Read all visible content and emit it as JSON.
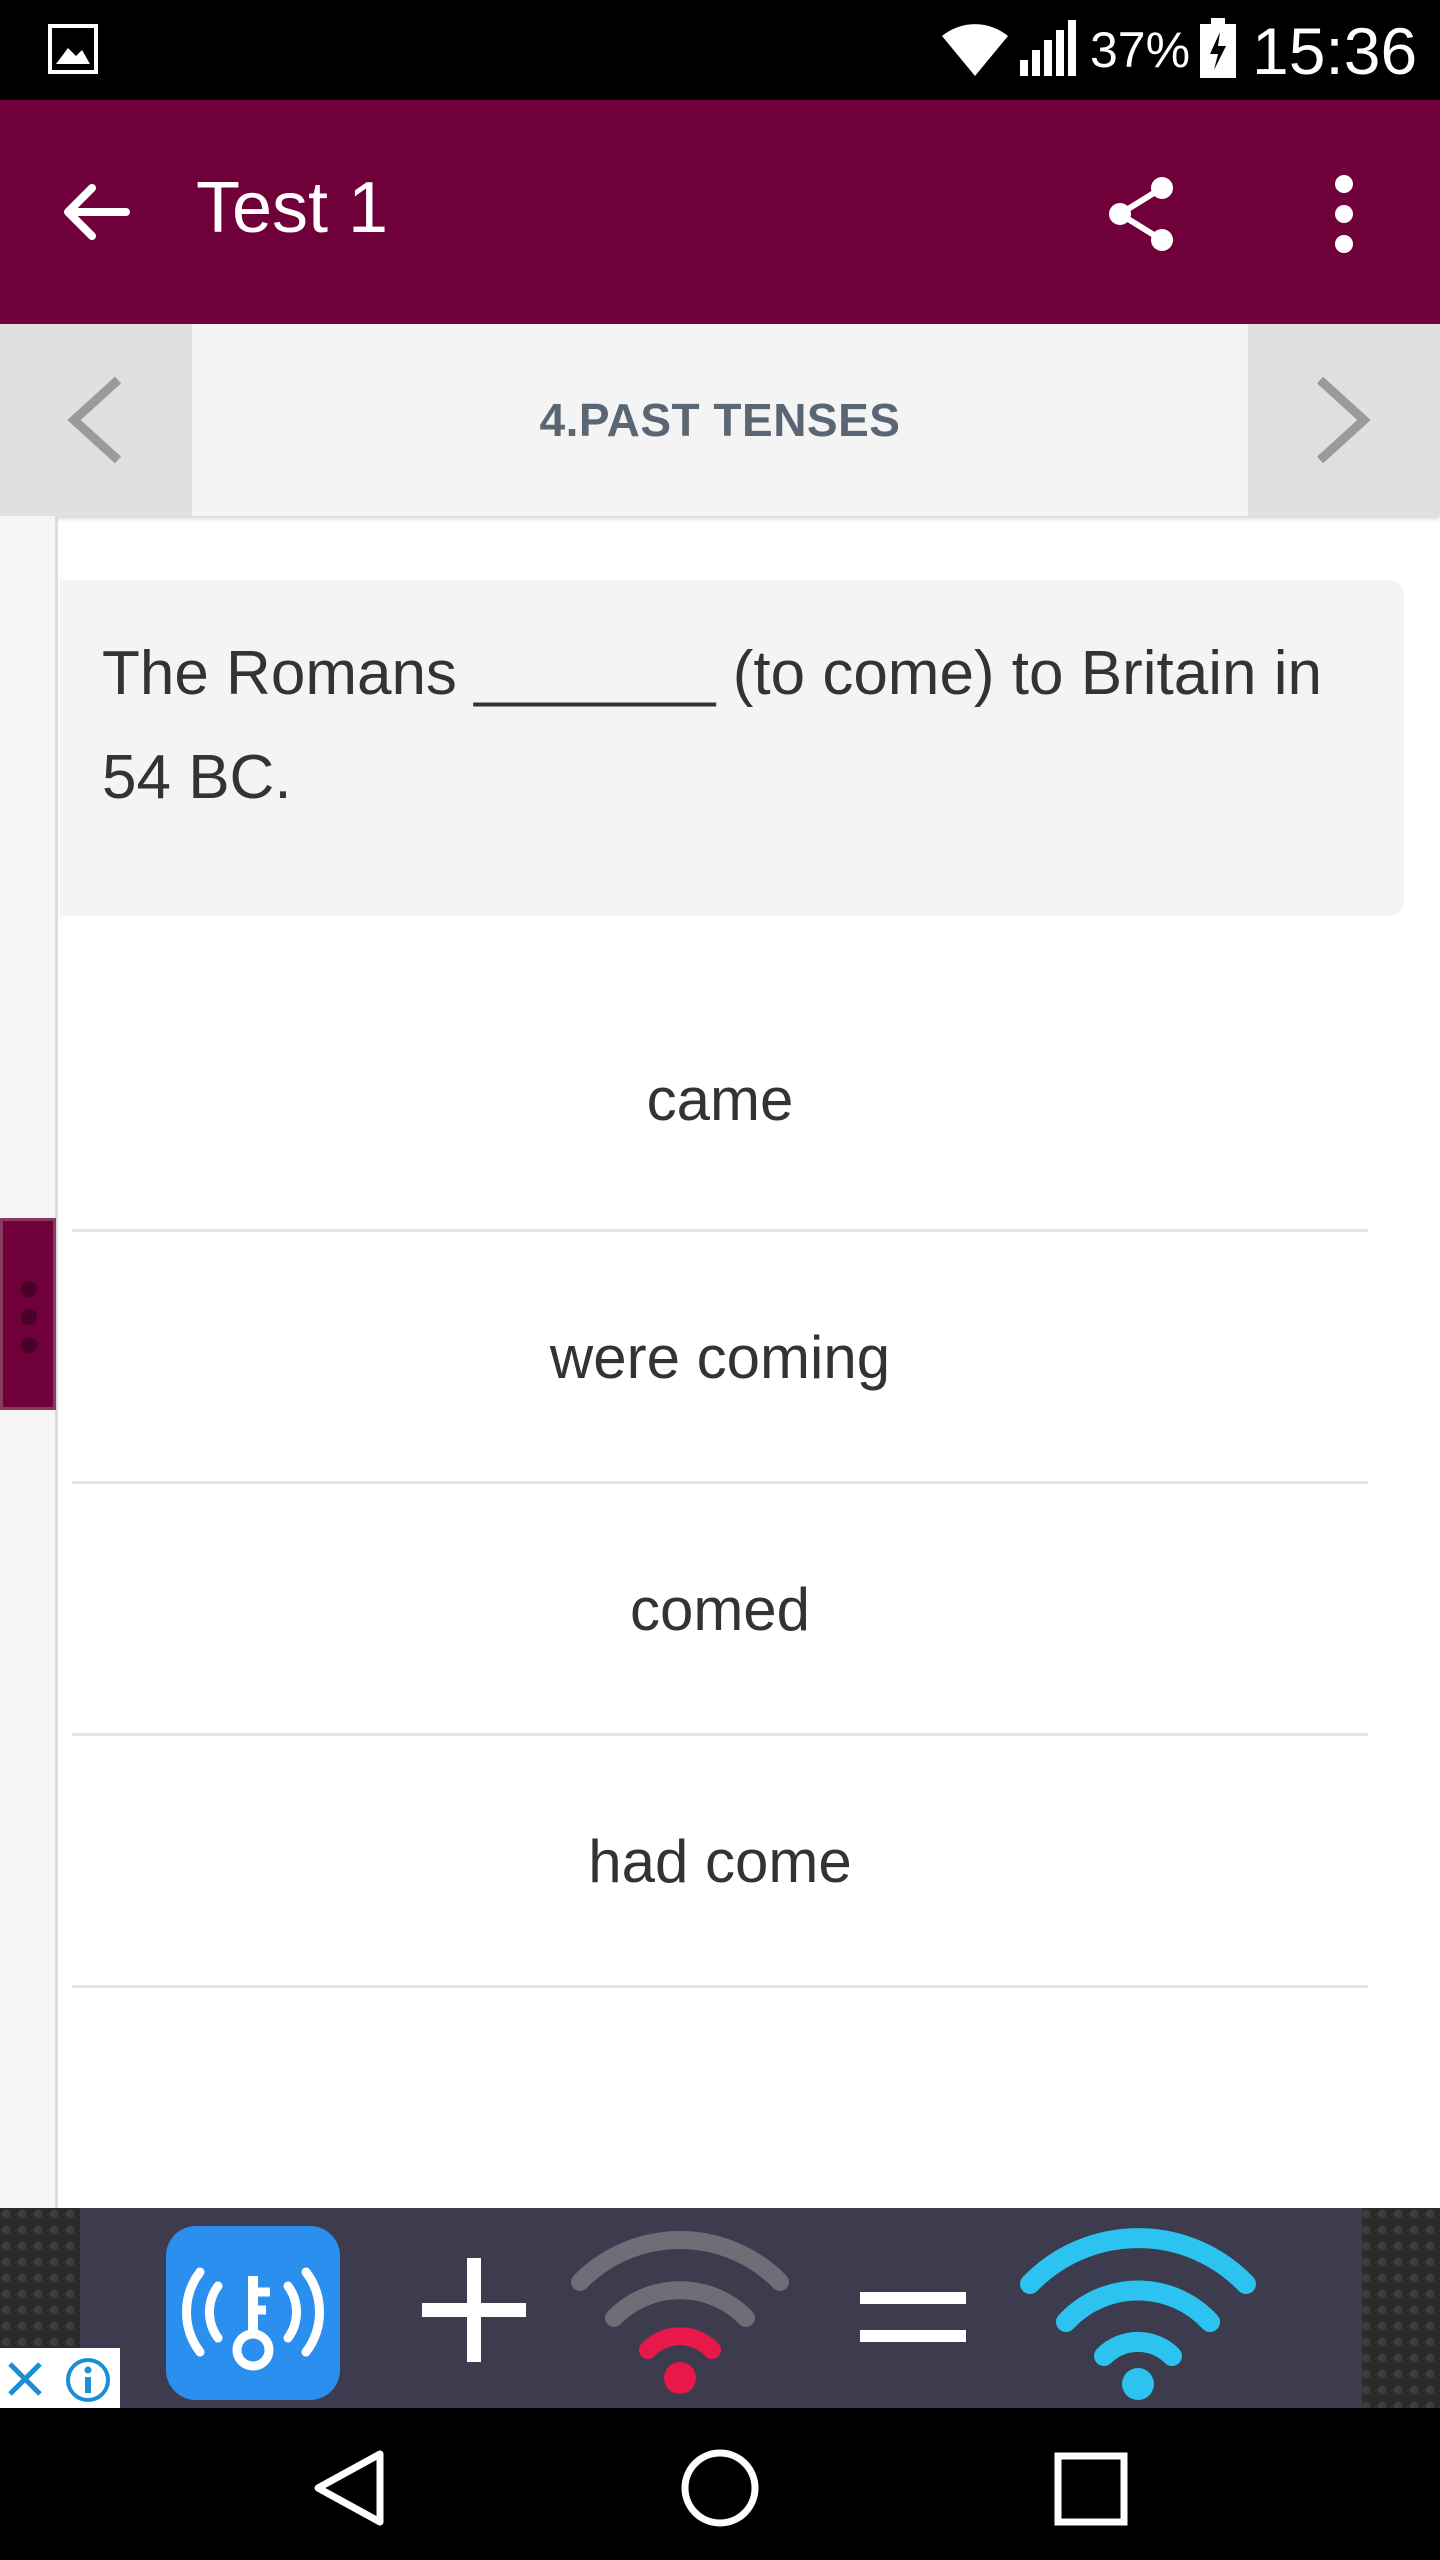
{
  "status_bar": {
    "battery_percent": "37%",
    "time": "15:36",
    "icons": [
      "gallery-icon",
      "wifi-icon",
      "signal-icon",
      "battery-charging-icon"
    ]
  },
  "app_bar": {
    "title": "Test 1",
    "background_color": "#70003a",
    "icons": [
      "back-arrow-icon",
      "share-icon",
      "more-vert-icon"
    ]
  },
  "section_nav": {
    "label": "4.PAST TENSES",
    "icons": [
      "chevron-left-icon",
      "chevron-right-icon"
    ]
  },
  "question": {
    "text": "The Romans _______ (to come) to Britain in 54 BC."
  },
  "answers": [
    {
      "label": "came"
    },
    {
      "label": "were coming"
    },
    {
      "label": "comed"
    },
    {
      "label": "had come"
    }
  ],
  "ad": {
    "icons": [
      "wifi-key-app-icon",
      "plus-icon",
      "wifi-weak-icon",
      "equals-icon",
      "wifi-full-icon",
      "close-icon",
      "info-icon"
    ]
  },
  "nav_bar": {
    "icons": [
      "nav-back-icon",
      "nav-home-icon",
      "nav-recents-icon"
    ]
  }
}
